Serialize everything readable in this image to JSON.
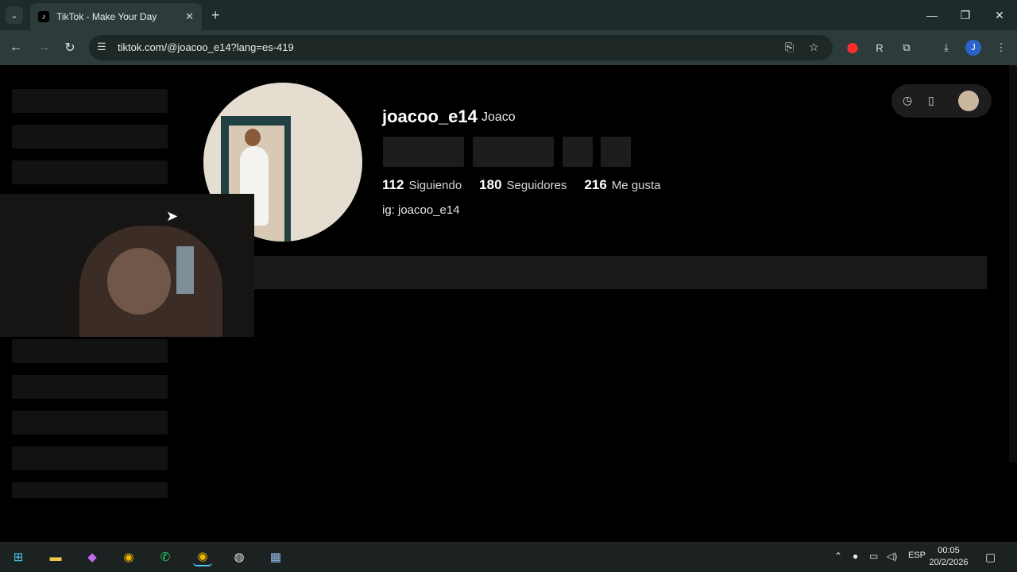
{
  "browser": {
    "tab_title": "TikTok - Make Your Day",
    "url": "tiktok.com/@joacoo_e14?lang=es-419",
    "profile_initial": "J"
  },
  "profile": {
    "username": "joacoo_e14",
    "nickname": "Joaco",
    "stats": [
      {
        "value": "112",
        "label": "Siguiendo"
      },
      {
        "value": "180",
        "label": "Seguidores"
      },
      {
        "value": "216",
        "label": "Me gusta"
      }
    ],
    "bio": "ig: joacoo_e14"
  },
  "taskbar": {
    "language": "ESP",
    "time": "00:05",
    "date": "20/2/2026"
  }
}
